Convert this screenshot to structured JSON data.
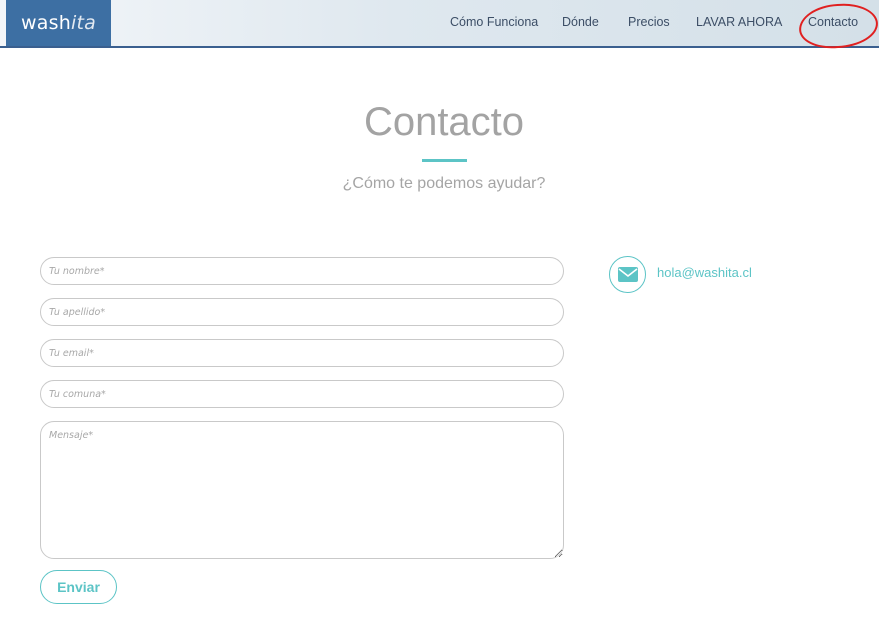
{
  "brand": {
    "logo_main": "wash",
    "logo_light": "ita"
  },
  "nav": {
    "items": [
      {
        "label": "Cómo Funciona"
      },
      {
        "label": "Dónde"
      },
      {
        "label": "Precios"
      },
      {
        "label": "LAVAR AHORA"
      },
      {
        "label": "Contacto"
      }
    ],
    "annotation_color": "#e02020"
  },
  "hero": {
    "title": "Contacto",
    "subtitle": "¿Cómo te podemos ayudar?"
  },
  "form": {
    "first_name_placeholder": "Tu nombre*",
    "last_name_placeholder": "Tu apellido*",
    "email_placeholder": "Tu email*",
    "comuna_placeholder": "Tu comuna*",
    "message_placeholder": "Mensaje*",
    "submit_label": "Enviar"
  },
  "contact": {
    "icon": "envelope-icon",
    "email": "hola@washita.cl"
  },
  "colors": {
    "accent": "#5cc4c6",
    "logo_bg": "#3d6fa3",
    "nav_text": "#3c4e66",
    "title_text": "#a3a3a3"
  }
}
